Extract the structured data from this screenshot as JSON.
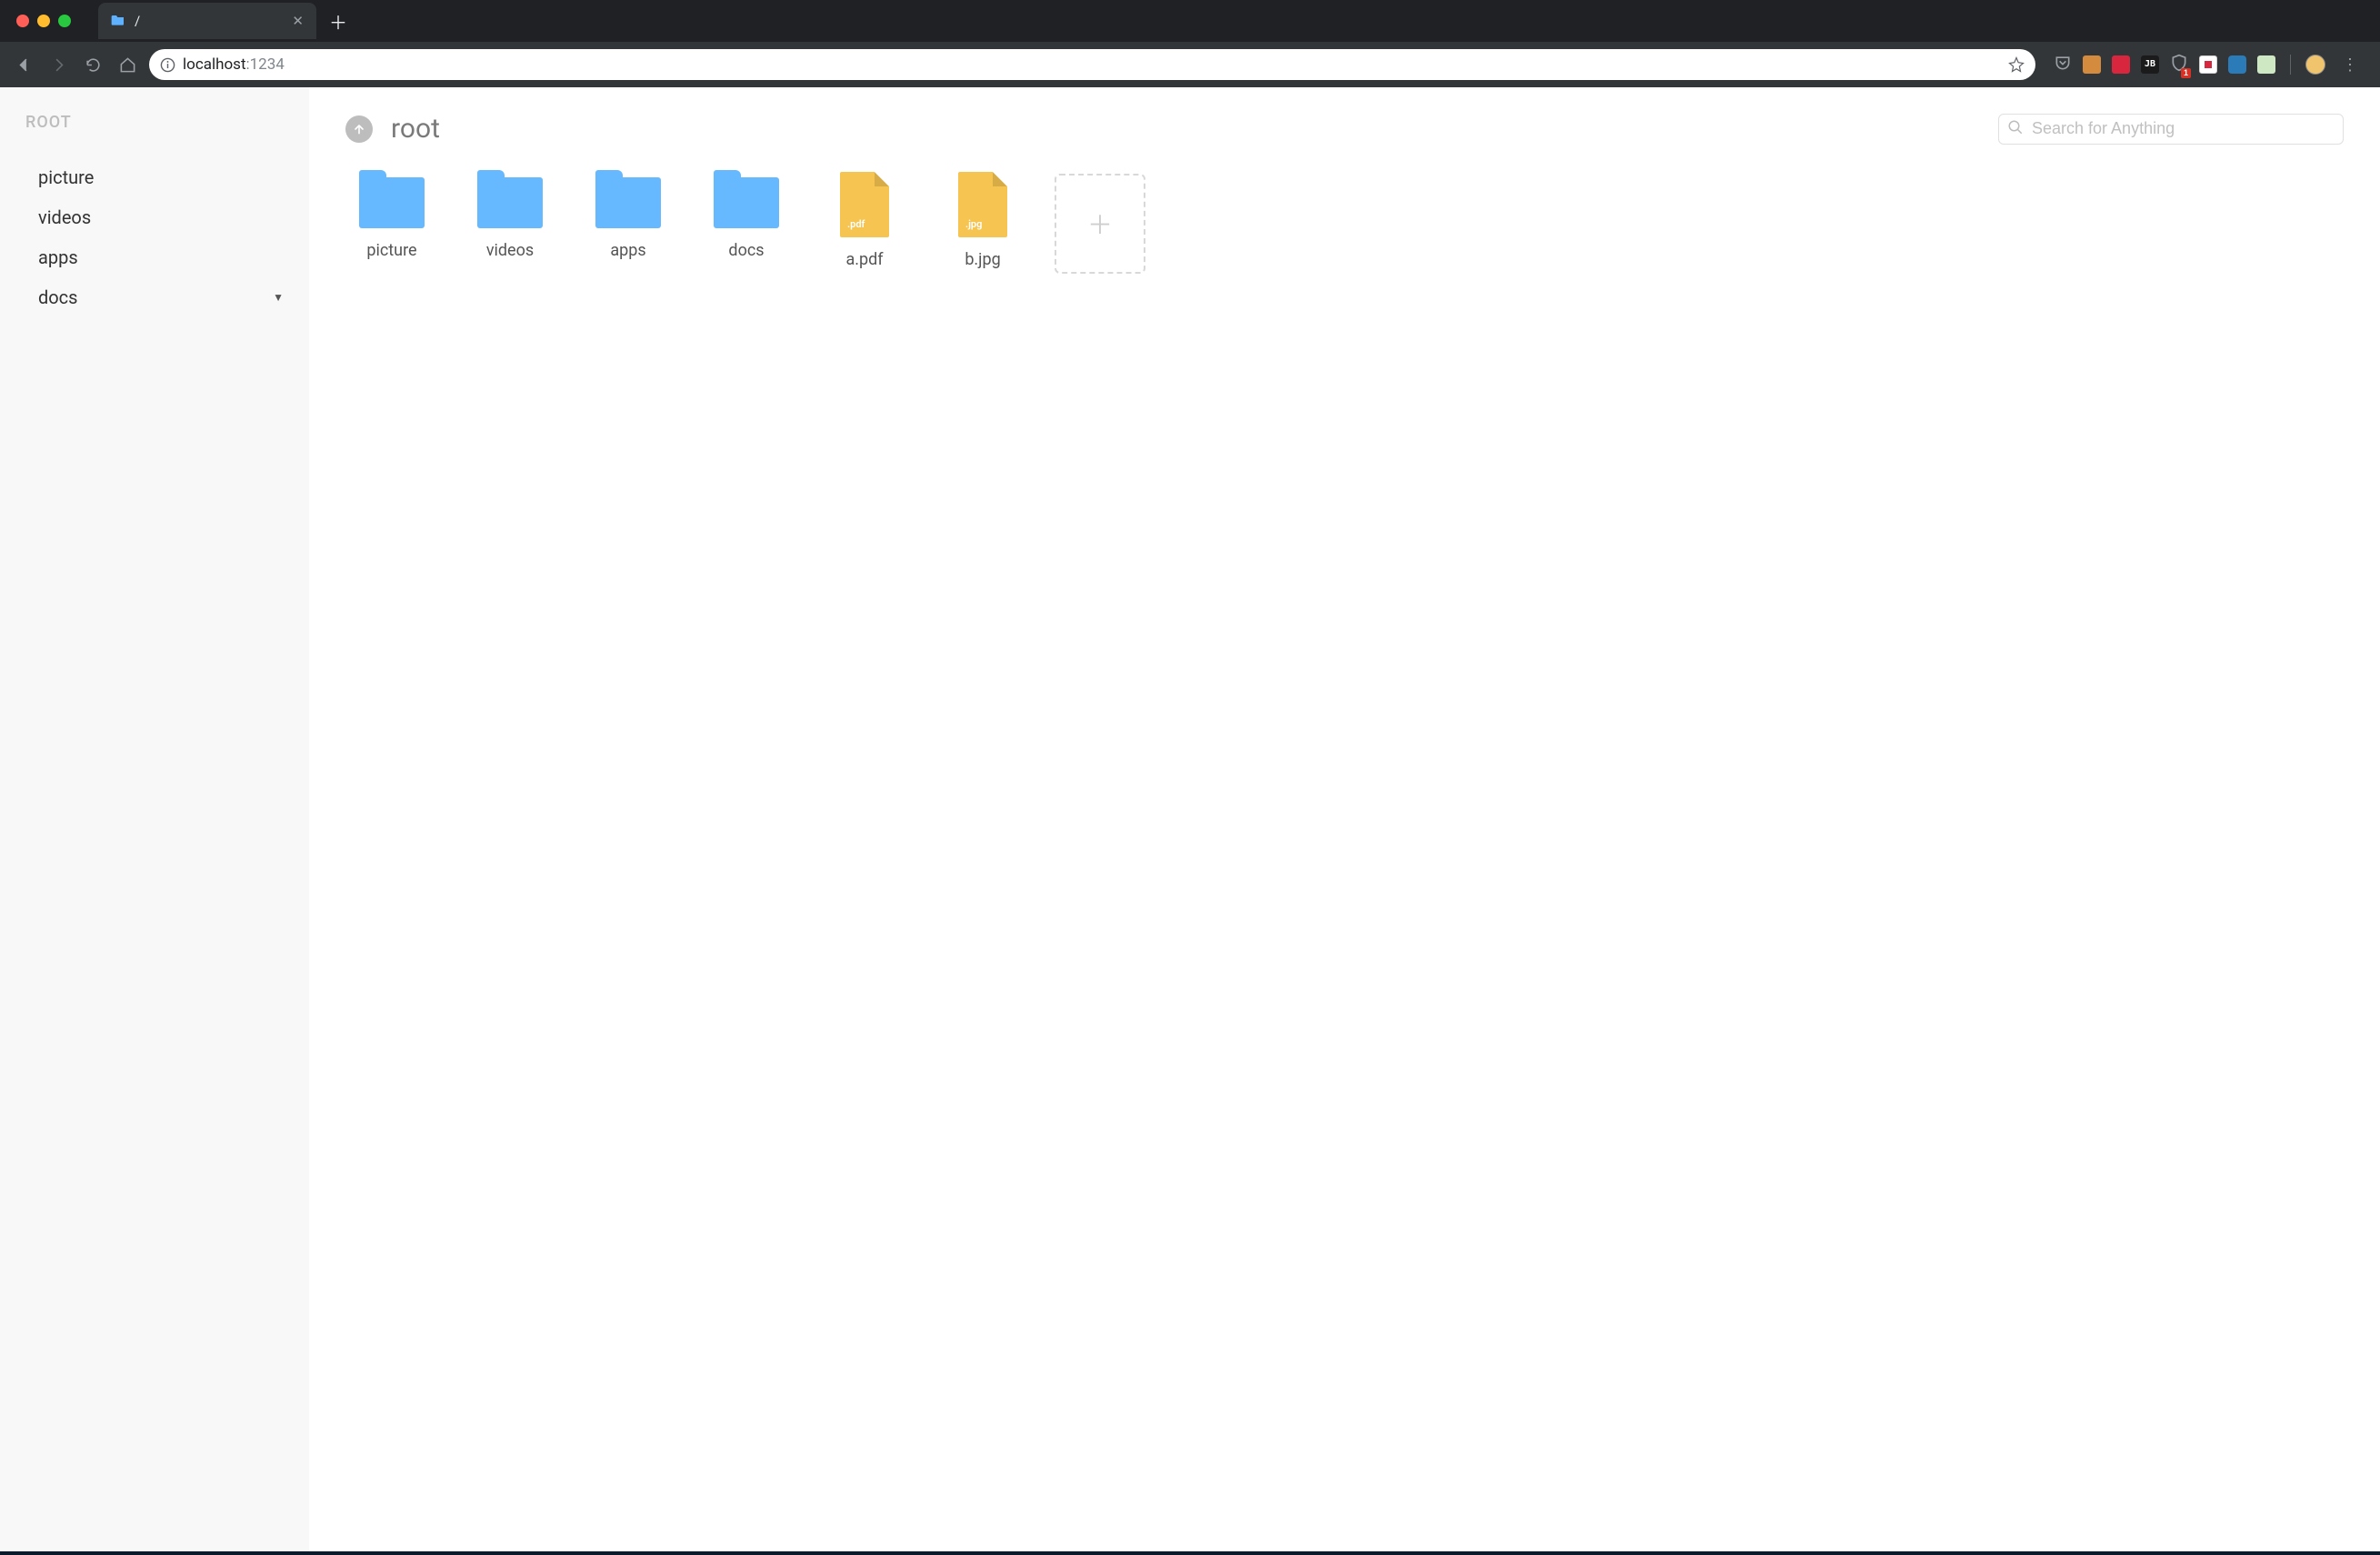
{
  "browser": {
    "tab_title": "/",
    "url_host": "localhost",
    "url_port": ":1234"
  },
  "sidebar": {
    "root_label": "ROOT",
    "items": [
      {
        "label": "picture",
        "expandable": false
      },
      {
        "label": "videos",
        "expandable": false
      },
      {
        "label": "apps",
        "expandable": false
      },
      {
        "label": "docs",
        "expandable": true
      }
    ]
  },
  "header": {
    "breadcrumb": "root",
    "search_placeholder": "Search for Anything"
  },
  "grid": {
    "items": [
      {
        "kind": "folder",
        "label": "picture"
      },
      {
        "kind": "folder",
        "label": "videos"
      },
      {
        "kind": "folder",
        "label": "apps"
      },
      {
        "kind": "folder",
        "label": "docs"
      },
      {
        "kind": "file",
        "label": "a.pdf",
        "ext": ".pdf"
      },
      {
        "kind": "file",
        "label": "b.jpg",
        "ext": ".jpg"
      }
    ]
  },
  "colors": {
    "folder": "#66b9ff",
    "file": "#f5c451",
    "sidebar_bg": "#f8f8f8"
  }
}
